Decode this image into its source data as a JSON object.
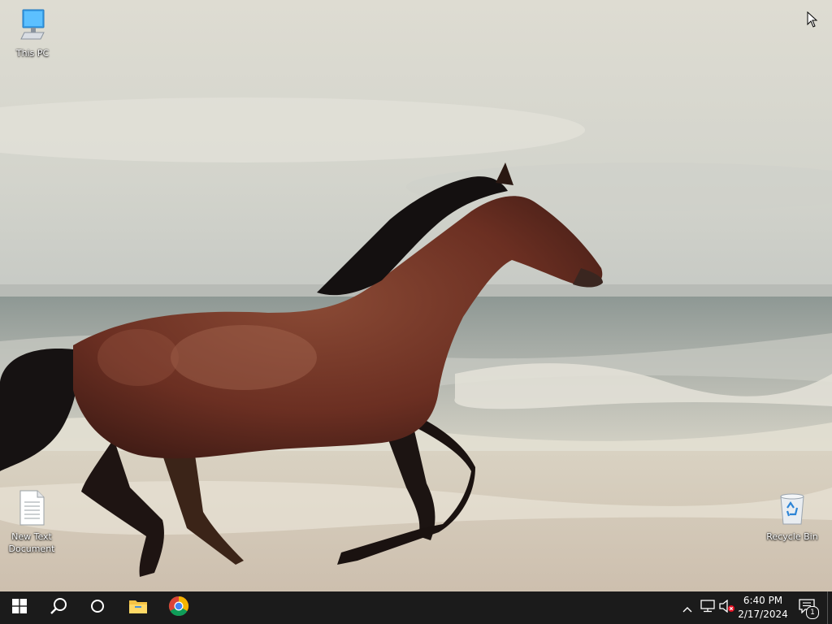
{
  "desktop": {
    "icons": [
      {
        "label": "This PC",
        "icon": "this-pc-icon"
      },
      {
        "label": "New Text Document",
        "icon": "text-document-icon"
      },
      {
        "label": "Recycle Bin",
        "icon": "recycle-bin-icon"
      }
    ],
    "wallpaper": "horse-on-beach-wallpaper"
  },
  "taskbar": {
    "apps": [
      {
        "name": "Start",
        "icon": "windows-start-icon"
      },
      {
        "name": "Search",
        "icon": "search-icon"
      },
      {
        "name": "Cortana",
        "icon": "cortana-icon"
      },
      {
        "name": "File Explorer",
        "icon": "file-explorer-icon"
      },
      {
        "name": "Google Chrome",
        "icon": "chrome-icon"
      }
    ],
    "tray": {
      "icons": [
        "chevron-up-icon",
        "network-icon",
        "volume-muted-icon"
      ],
      "time": "6:40 PM",
      "date": "2/17/2024",
      "notification_count": "1"
    }
  },
  "colors": {
    "taskbar_bg": "#1b1b1b",
    "accent": "#76b9ed"
  }
}
